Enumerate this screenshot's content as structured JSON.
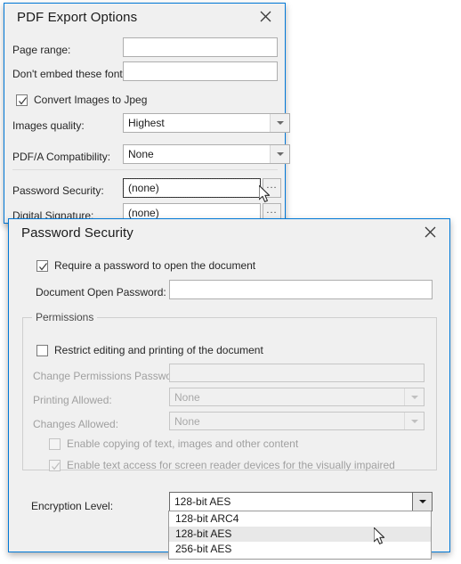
{
  "export_dialog": {
    "title": "PDF Export Options",
    "close_icon": "close-icon",
    "fields": {
      "page_range_label": "Page range:",
      "page_range_value": "",
      "dont_embed_label": "Don't embed these fonts:",
      "dont_embed_value": "",
      "convert_images_label": "Convert Images to Jpeg",
      "convert_images_checked": true,
      "images_quality_label": "Images quality:",
      "images_quality_value": "Highest",
      "pdfa_label": "PDF/A Compatibility:",
      "pdfa_value": "None",
      "password_security_label": "Password Security:",
      "password_security_value": "(none)",
      "digital_signature_label": "Digital Signature:",
      "digital_signature_value": "(none)",
      "browse_button_label": "..."
    }
  },
  "password_dialog": {
    "title": "Password Security",
    "close_icon": "close-icon",
    "require_password_label": "Require a password to open the document",
    "require_password_checked": true,
    "document_open_password_label": "Document Open Password:",
    "document_open_password_value": "",
    "permissions": {
      "group_title": "Permissions",
      "restrict_label": "Restrict editing and printing of the document",
      "restrict_checked": false,
      "change_permissions_label": "Change Permissions Password:",
      "change_permissions_value": "",
      "printing_allowed_label": "Printing Allowed:",
      "printing_allowed_value": "None",
      "changes_allowed_label": "Changes Allowed:",
      "changes_allowed_value": "None",
      "enable_copy_label": "Enable copying of text, images and other content",
      "enable_copy_checked": false,
      "enable_screen_reader_label": "Enable text access for screen reader devices for the visually impaired",
      "enable_screen_reader_checked": true
    },
    "encryption": {
      "label": "Encryption Level:",
      "value": "128-bit AES",
      "options": [
        "128-bit ARC4",
        "128-bit AES",
        "256-bit AES"
      ],
      "selected_index": 1
    }
  },
  "colors": {
    "accent_border": "#0078d7",
    "dialog_bg": "#f0f0f0",
    "field_bg": "#ffffff",
    "text": "#262626",
    "disabled_text": "#a0a0a0",
    "highlight_row": "#e8e8e8"
  }
}
